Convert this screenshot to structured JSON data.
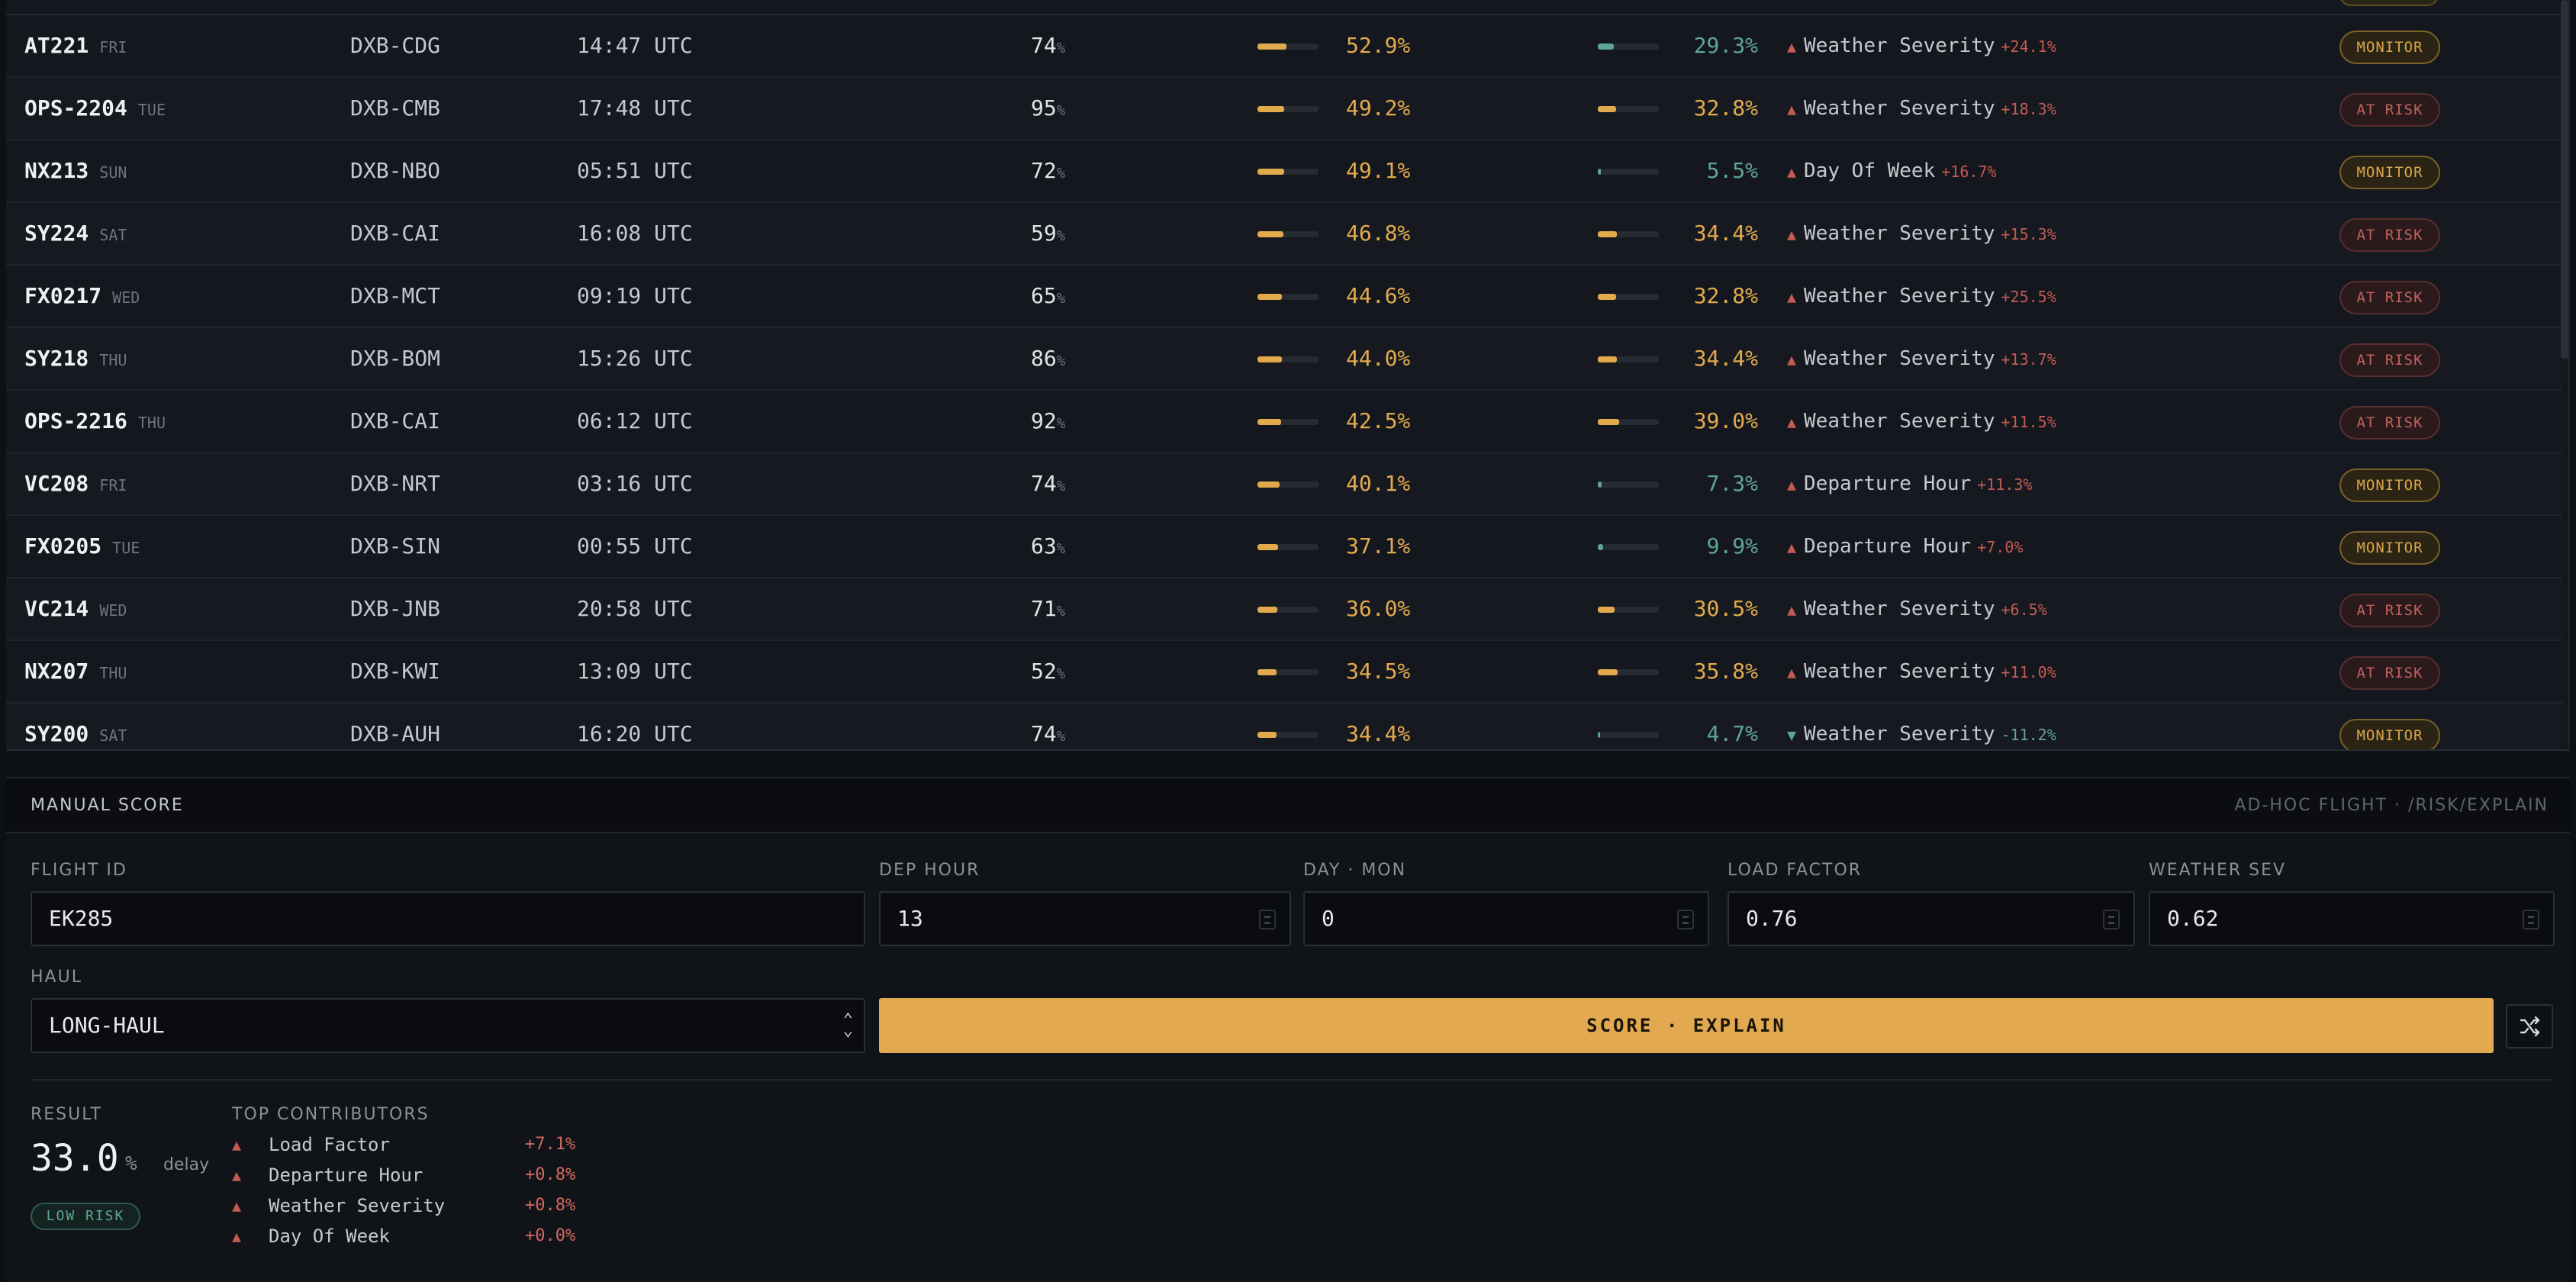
{
  "flights": [
    {
      "flight": "AT221",
      "day": "FRI",
      "route": "DXB-CDG",
      "time": "14:47 UTC",
      "load": "74",
      "load_unit": "%",
      "p1": 52.9,
      "p1_label": "52.9%",
      "p2": 29.3,
      "p2_label": "29.3%",
      "p2_color": "#5fa596",
      "driver": "Weather Severity",
      "direction": "up",
      "arrow": "▲",
      "delta": "+24.1%",
      "status": "MONITOR"
    },
    {
      "flight": "OPS-2204",
      "day": "TUE",
      "route": "DXB-CMB",
      "time": "17:48 UTC",
      "load": "95",
      "load_unit": "%",
      "p1": 49.2,
      "p1_label": "49.2%",
      "p2": 32.8,
      "p2_label": "32.8%",
      "p2_color": "#e2aa4d",
      "driver": "Weather Severity",
      "direction": "up",
      "arrow": "▲",
      "delta": "+18.3%",
      "status": "AT RISK"
    },
    {
      "flight": "NX213",
      "day": "SUN",
      "route": "DXB-NBO",
      "time": "05:51 UTC",
      "load": "72",
      "load_unit": "%",
      "p1": 49.1,
      "p1_label": "49.1%",
      "p2": 5.5,
      "p2_label": "5.5%",
      "p2_color": "#5fa596",
      "driver": "Day Of Week",
      "direction": "up",
      "arrow": "▲",
      "delta": "+16.7%",
      "status": "MONITOR"
    },
    {
      "flight": "SY224",
      "day": "SAT",
      "route": "DXB-CAI",
      "time": "16:08 UTC",
      "load": "59",
      "load_unit": "%",
      "p1": 46.8,
      "p1_label": "46.8%",
      "p2": 34.4,
      "p2_label": "34.4%",
      "p2_color": "#e2aa4d",
      "driver": "Weather Severity",
      "direction": "up",
      "arrow": "▲",
      "delta": "+15.3%",
      "status": "AT RISK"
    },
    {
      "flight": "FX0217",
      "day": "WED",
      "route": "DXB-MCT",
      "time": "09:19 UTC",
      "load": "65",
      "load_unit": "%",
      "p1": 44.6,
      "p1_label": "44.6%",
      "p2": 32.8,
      "p2_label": "32.8%",
      "p2_color": "#e2aa4d",
      "driver": "Weather Severity",
      "direction": "up",
      "arrow": "▲",
      "delta": "+25.5%",
      "status": "AT RISK"
    },
    {
      "flight": "SY218",
      "day": "THU",
      "route": "DXB-BOM",
      "time": "15:26 UTC",
      "load": "86",
      "load_unit": "%",
      "p1": 44.0,
      "p1_label": "44.0%",
      "p2": 34.4,
      "p2_label": "34.4%",
      "p2_color": "#e2aa4d",
      "driver": "Weather Severity",
      "direction": "up",
      "arrow": "▲",
      "delta": "+13.7%",
      "status": "AT RISK"
    },
    {
      "flight": "OPS-2216",
      "day": "THU",
      "route": "DXB-CAI",
      "time": "06:12 UTC",
      "load": "92",
      "load_unit": "%",
      "p1": 42.5,
      "p1_label": "42.5%",
      "p2": 39.0,
      "p2_label": "39.0%",
      "p2_color": "#e2aa4d",
      "driver": "Weather Severity",
      "direction": "up",
      "arrow": "▲",
      "delta": "+11.5%",
      "status": "AT RISK"
    },
    {
      "flight": "VC208",
      "day": "FRI",
      "route": "DXB-NRT",
      "time": "03:16 UTC",
      "load": "74",
      "load_unit": "%",
      "p1": 40.1,
      "p1_label": "40.1%",
      "p2": 7.3,
      "p2_label": "7.3%",
      "p2_color": "#5fa596",
      "driver": "Departure Hour",
      "direction": "up",
      "arrow": "▲",
      "delta": "+11.3%",
      "status": "MONITOR"
    },
    {
      "flight": "FX0205",
      "day": "TUE",
      "route": "DXB-SIN",
      "time": "00:55 UTC",
      "load": "63",
      "load_unit": "%",
      "p1": 37.1,
      "p1_label": "37.1%",
      "p2": 9.9,
      "p2_label": "9.9%",
      "p2_color": "#5fa596",
      "driver": "Departure Hour",
      "direction": "up",
      "arrow": "▲",
      "delta": "+7.0%",
      "status": "MONITOR"
    },
    {
      "flight": "VC214",
      "day": "WED",
      "route": "DXB-JNB",
      "time": "20:58 UTC",
      "load": "71",
      "load_unit": "%",
      "p1": 36.0,
      "p1_label": "36.0%",
      "p2": 30.5,
      "p2_label": "30.5%",
      "p2_color": "#e2aa4d",
      "driver": "Weather Severity",
      "direction": "up",
      "arrow": "▲",
      "delta": "+6.5%",
      "status": "AT RISK"
    },
    {
      "flight": "NX207",
      "day": "THU",
      "route": "DXB-KWI",
      "time": "13:09 UTC",
      "load": "52",
      "load_unit": "%",
      "p1": 34.5,
      "p1_label": "34.5%",
      "p2": 35.8,
      "p2_label": "35.8%",
      "p2_color": "#e2aa4d",
      "driver": "Weather Severity",
      "direction": "up",
      "arrow": "▲",
      "delta": "+11.0%",
      "status": "AT RISK"
    },
    {
      "flight": "SY200",
      "day": "SAT",
      "route": "DXB-AUH",
      "time": "16:20 UTC",
      "load": "74",
      "load_unit": "%",
      "p1": 34.4,
      "p1_label": "34.4%",
      "p2": 4.7,
      "p2_label": "4.7%",
      "p2_color": "#5fa596",
      "driver": "Weather Severity",
      "direction": "down",
      "arrow": "▼",
      "delta": "-11.2%",
      "status": "MONITOR"
    }
  ],
  "colors": {
    "accent": "#e2aa4d",
    "positive": "#5fa596",
    "negative": "#c45a54"
  },
  "manual": {
    "title": "MANUAL SCORE",
    "subtitle": "AD-HOC FLIGHT · /RISK/EXPLAIN",
    "fields": {
      "flight_id": {
        "label": "FLIGHT ID",
        "value": "EK285"
      },
      "dep_hour": {
        "label": "DEP HOUR",
        "value": "13"
      },
      "day_mon": {
        "label": "DAY · MON",
        "value": "0"
      },
      "load_factor": {
        "label": "LOAD FACTOR",
        "value": "0.76"
      },
      "weather_sev": {
        "label": "WEATHER SEV",
        "value": "0.62"
      },
      "haul": {
        "label": "HAUL",
        "value": "LONG-HAUL"
      }
    },
    "score_button": "SCORE · EXPLAIN",
    "shuffle_icon": "shuffle-icon",
    "result": {
      "label": "RESULT",
      "value": "33.0",
      "unit": "%",
      "suffix": "delay",
      "risk": "LOW RISK"
    },
    "contributors_label": "TOP CONTRIBUTORS",
    "contributors": [
      {
        "arrow": "▲",
        "name": "Load Factor",
        "value": "+7.1%"
      },
      {
        "arrow": "▲",
        "name": "Departure Hour",
        "value": "+0.8%"
      },
      {
        "arrow": "▲",
        "name": "Weather Severity",
        "value": "+0.8%"
      },
      {
        "arrow": "▲",
        "name": "Day Of Week",
        "value": "+0.0%"
      }
    ]
  }
}
